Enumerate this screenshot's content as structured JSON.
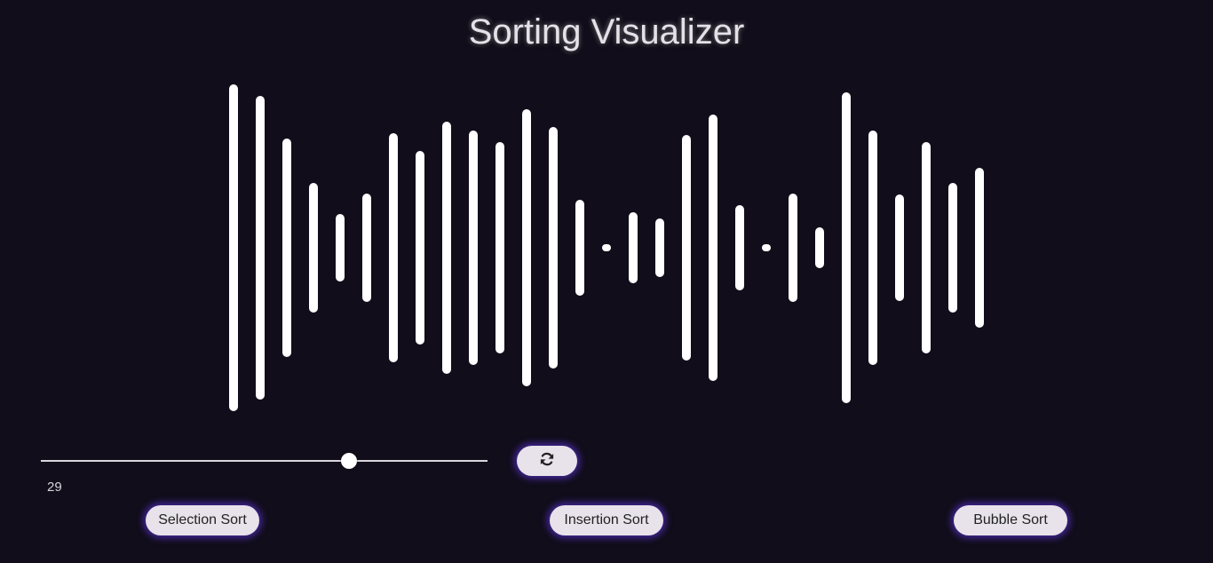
{
  "header": {
    "title": "Sorting Visualizer"
  },
  "theme": {
    "background": "#110d1a",
    "bar_color": "#ffffff",
    "button_bg": "#e8e3ea",
    "button_glow": "#5630c8"
  },
  "array": {
    "values": [
      96,
      89,
      64,
      38,
      20,
      32,
      67,
      57,
      74,
      69,
      62,
      81,
      71,
      28,
      1,
      21,
      17,
      66,
      78,
      25,
      1,
      32,
      12,
      91,
      69,
      31,
      62,
      38,
      47
    ],
    "max": 100
  },
  "controls": {
    "size_slider": {
      "value": 29,
      "fraction": 0.69,
      "display": "29"
    },
    "refresh_icon": "refresh-icon"
  },
  "buttons": {
    "selection_sort": "Selection Sort",
    "insertion_sort": "Insertion Sort",
    "bubble_sort": "Bubble Sort"
  }
}
